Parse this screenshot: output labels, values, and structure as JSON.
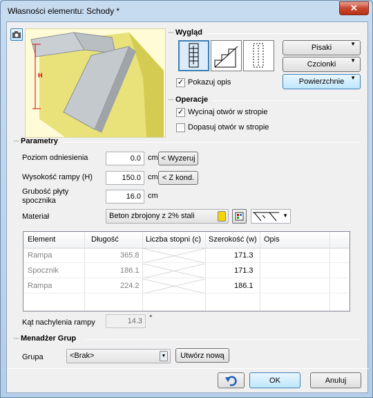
{
  "window": {
    "title": "Własności elementu: Schody *",
    "close": "✕"
  },
  "preview": {
    "dim_label": "H"
  },
  "look": {
    "title": "Wygląd",
    "pisaki": "Pisaki",
    "czcionki": "Czcionki",
    "powierzchnie": "Powierzchnie",
    "show_desc_label": "Pokazuj opis",
    "show_desc_checked": "✓"
  },
  "ops": {
    "title": "Operacje",
    "cut_label": "Wycinaj otwór w stropie",
    "cut_checked": "✓",
    "fit_label": "Dopasuj otwór w stropie",
    "fit_checked": ""
  },
  "params": {
    "title": "Parametry",
    "level_label": "Poziom odniesienia",
    "level_value": "0.0",
    "level_unit": "cm",
    "level_btn": "< Wyzeruj",
    "height_label": "Wysokość rampy (H)",
    "height_value": "150.0",
    "height_unit": "cm",
    "height_btn": "< Z kond.",
    "thick_label_1": "Grubość płyty",
    "thick_label_2": "spocznika",
    "thick_value": "16.0",
    "thick_unit": "cm",
    "material_label": "Materiał",
    "material_value": "Beton zbrojony z 2% stali"
  },
  "table": {
    "headers": [
      "Element",
      "Długość",
      "Liczba stopni (c)",
      "Szerokość (w)",
      "Opis"
    ],
    "rows": [
      {
        "element": "Rampa",
        "length": "365.8",
        "width": "171.3"
      },
      {
        "element": "Spocznik",
        "length": "186.1",
        "width": "171.3"
      },
      {
        "element": "Rampa",
        "length": "224.2",
        "width": "186.1"
      }
    ]
  },
  "angle": {
    "label": "Kąt nachylenia rampy",
    "value": "14.3",
    "unit": "°"
  },
  "groups": {
    "title": "Menadżer Grup",
    "group_label": "Grupa",
    "group_value": "<Brak>",
    "create_btn": "Utwórz nową"
  },
  "footer": {
    "ok": "OK",
    "cancel": "Anuluj"
  }
}
